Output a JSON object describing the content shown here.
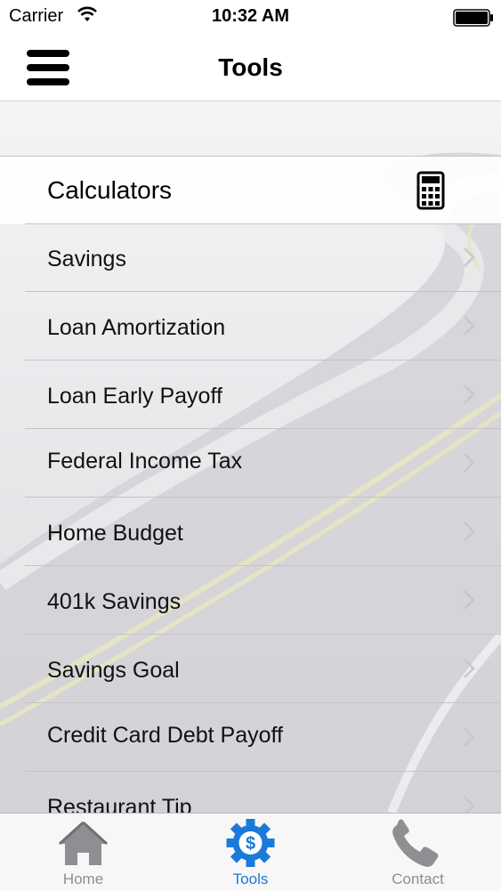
{
  "status_bar": {
    "carrier": "Carrier",
    "time": "10:32 AM"
  },
  "nav": {
    "title": "Tools"
  },
  "section": {
    "title": "Calculators"
  },
  "items": [
    {
      "label": "Savings"
    },
    {
      "label": "Loan Amortization"
    },
    {
      "label": "Loan Early Payoff"
    },
    {
      "label": "Federal Income Tax"
    },
    {
      "label": "Home Budget"
    },
    {
      "label": "401k Savings"
    },
    {
      "label": "Savings Goal"
    },
    {
      "label": "Credit Card Debt Payoff"
    },
    {
      "label": "Restaurant Tip"
    }
  ],
  "tabs": [
    {
      "label": "Home",
      "icon": "home-icon"
    },
    {
      "label": "Tools",
      "icon": "gear-dollar-icon",
      "active": true
    },
    {
      "label": "Contact",
      "icon": "phone-icon"
    }
  ],
  "colors": {
    "active_tab": "#1a7ad9",
    "inactive_tab": "#8e8e93"
  }
}
